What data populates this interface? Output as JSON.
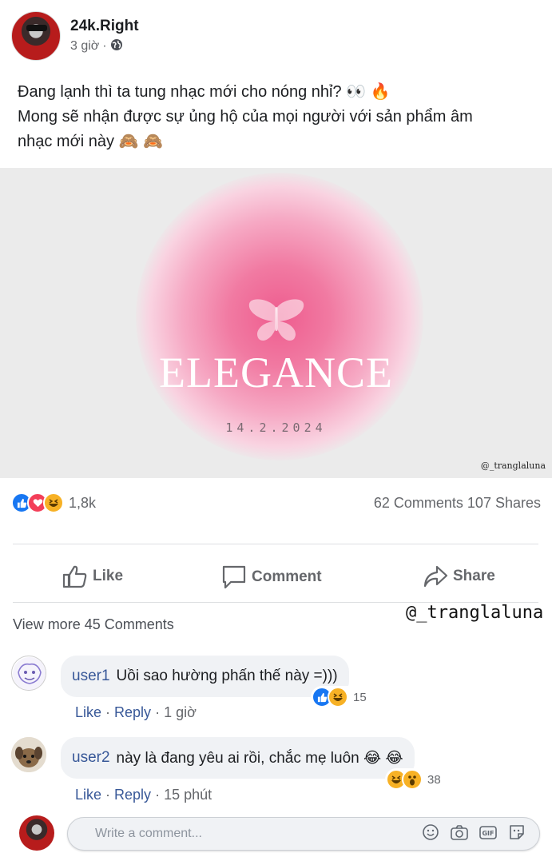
{
  "post": {
    "author": "24k.Right",
    "time": "3 giờ",
    "separator": "·",
    "privacy_icon": "globe-icon",
    "text_lines": [
      "Đang lạnh thì ta tung nhạc mới cho nóng nhỉ? 👀 🔥",
      "Mong sẽ nhận được sự ủng hộ của mọi người với sản phẩm âm",
      "nhạc mới này 🙈 🙈"
    ]
  },
  "media": {
    "title": "ELEGANCE",
    "date": "14.2.2024",
    "watermark": "@_tranglaluna",
    "background": "#ebebeb",
    "accent": "#ee5c8e"
  },
  "stats": {
    "reaction_count": "1,8k",
    "comments": "62 Comments",
    "shares": "107 Shares"
  },
  "actions": {
    "like": "Like",
    "comment": "Comment",
    "share": "Share"
  },
  "comments_section": {
    "view_more": "View more 45 Comments",
    "watermark": "@_tranglaluna",
    "items": [
      {
        "user": "user1",
        "text": "Uồi sao hường phấn thế này =)))",
        "like": "Like",
        "reply": "Reply",
        "time": "1 giờ",
        "reaction_count": "15"
      },
      {
        "user": "user2",
        "text": "này là đang yêu ai rồi, chắc mẹ luôn 😂 😂",
        "like": "Like",
        "reply": "Reply",
        "time": "15 phút",
        "reaction_count": "38"
      }
    ]
  },
  "composer": {
    "placeholder": "Write a comment..."
  },
  "colors": {
    "link": "#385898",
    "like_blue": "#1877f2",
    "love_red": "#f33e58",
    "haha_yellow": "#f7b125",
    "muted": "#65676b"
  }
}
